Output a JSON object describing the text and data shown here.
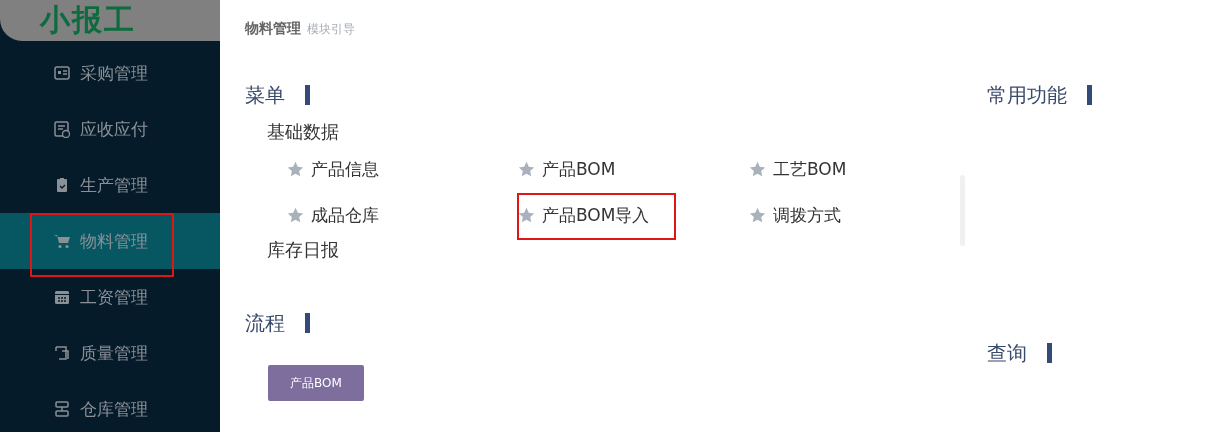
{
  "logo": "小报工",
  "sidebar": {
    "items": [
      {
        "label": "采购管理",
        "selected": false,
        "highlighted": false
      },
      {
        "label": "应收应付",
        "selected": false,
        "highlighted": false
      },
      {
        "label": "生产管理",
        "selected": false,
        "highlighted": false
      },
      {
        "label": "物料管理",
        "selected": true,
        "highlighted": true
      },
      {
        "label": "工资管理",
        "selected": false,
        "highlighted": false
      },
      {
        "label": "质量管理",
        "selected": false,
        "highlighted": false
      },
      {
        "label": "仓库管理",
        "selected": false,
        "highlighted": false
      }
    ]
  },
  "breadcrumb": {
    "title": "物料管理",
    "subtitle": "模块引导"
  },
  "menu": {
    "title": "菜单",
    "groups": [
      {
        "label": "基础数据",
        "items": [
          {
            "label": "产品信息",
            "highlighted": false
          },
          {
            "label": "产品BOM",
            "highlighted": false
          },
          {
            "label": "工艺BOM",
            "highlighted": false
          },
          {
            "label": "成品仓库",
            "highlighted": false
          },
          {
            "label": "产品BOM导入",
            "highlighted": true
          },
          {
            "label": "调拨方式",
            "highlighted": false
          }
        ]
      },
      {
        "label": "库存日报"
      }
    ]
  },
  "flow": {
    "title": "流程",
    "buttons": [
      "产品BOM"
    ]
  },
  "common": {
    "title": "常用功能"
  },
  "query": {
    "title": "查询"
  }
}
